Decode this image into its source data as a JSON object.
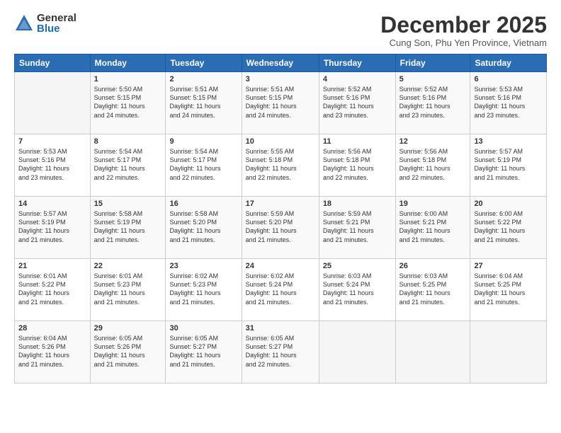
{
  "header": {
    "logo_general": "General",
    "logo_blue": "Blue",
    "month": "December 2025",
    "location": "Cung Son, Phu Yen Province, Vietnam"
  },
  "days_of_week": [
    "Sunday",
    "Monday",
    "Tuesday",
    "Wednesday",
    "Thursday",
    "Friday",
    "Saturday"
  ],
  "weeks": [
    [
      {
        "day": "",
        "info": ""
      },
      {
        "day": "1",
        "info": "Sunrise: 5:50 AM\nSunset: 5:15 PM\nDaylight: 11 hours\nand 24 minutes."
      },
      {
        "day": "2",
        "info": "Sunrise: 5:51 AM\nSunset: 5:15 PM\nDaylight: 11 hours\nand 24 minutes."
      },
      {
        "day": "3",
        "info": "Sunrise: 5:51 AM\nSunset: 5:15 PM\nDaylight: 11 hours\nand 24 minutes."
      },
      {
        "day": "4",
        "info": "Sunrise: 5:52 AM\nSunset: 5:16 PM\nDaylight: 11 hours\nand 23 minutes."
      },
      {
        "day": "5",
        "info": "Sunrise: 5:52 AM\nSunset: 5:16 PM\nDaylight: 11 hours\nand 23 minutes."
      },
      {
        "day": "6",
        "info": "Sunrise: 5:53 AM\nSunset: 5:16 PM\nDaylight: 11 hours\nand 23 minutes."
      }
    ],
    [
      {
        "day": "7",
        "info": "Sunrise: 5:53 AM\nSunset: 5:16 PM\nDaylight: 11 hours\nand 23 minutes."
      },
      {
        "day": "8",
        "info": "Sunrise: 5:54 AM\nSunset: 5:17 PM\nDaylight: 11 hours\nand 22 minutes."
      },
      {
        "day": "9",
        "info": "Sunrise: 5:54 AM\nSunset: 5:17 PM\nDaylight: 11 hours\nand 22 minutes."
      },
      {
        "day": "10",
        "info": "Sunrise: 5:55 AM\nSunset: 5:18 PM\nDaylight: 11 hours\nand 22 minutes."
      },
      {
        "day": "11",
        "info": "Sunrise: 5:56 AM\nSunset: 5:18 PM\nDaylight: 11 hours\nand 22 minutes."
      },
      {
        "day": "12",
        "info": "Sunrise: 5:56 AM\nSunset: 5:18 PM\nDaylight: 11 hours\nand 22 minutes."
      },
      {
        "day": "13",
        "info": "Sunrise: 5:57 AM\nSunset: 5:19 PM\nDaylight: 11 hours\nand 21 minutes."
      }
    ],
    [
      {
        "day": "14",
        "info": "Sunrise: 5:57 AM\nSunset: 5:19 PM\nDaylight: 11 hours\nand 21 minutes."
      },
      {
        "day": "15",
        "info": "Sunrise: 5:58 AM\nSunset: 5:19 PM\nDaylight: 11 hours\nand 21 minutes."
      },
      {
        "day": "16",
        "info": "Sunrise: 5:58 AM\nSunset: 5:20 PM\nDaylight: 11 hours\nand 21 minutes."
      },
      {
        "day": "17",
        "info": "Sunrise: 5:59 AM\nSunset: 5:20 PM\nDaylight: 11 hours\nand 21 minutes."
      },
      {
        "day": "18",
        "info": "Sunrise: 5:59 AM\nSunset: 5:21 PM\nDaylight: 11 hours\nand 21 minutes."
      },
      {
        "day": "19",
        "info": "Sunrise: 6:00 AM\nSunset: 5:21 PM\nDaylight: 11 hours\nand 21 minutes."
      },
      {
        "day": "20",
        "info": "Sunrise: 6:00 AM\nSunset: 5:22 PM\nDaylight: 11 hours\nand 21 minutes."
      }
    ],
    [
      {
        "day": "21",
        "info": "Sunrise: 6:01 AM\nSunset: 5:22 PM\nDaylight: 11 hours\nand 21 minutes."
      },
      {
        "day": "22",
        "info": "Sunrise: 6:01 AM\nSunset: 5:23 PM\nDaylight: 11 hours\nand 21 minutes."
      },
      {
        "day": "23",
        "info": "Sunrise: 6:02 AM\nSunset: 5:23 PM\nDaylight: 11 hours\nand 21 minutes."
      },
      {
        "day": "24",
        "info": "Sunrise: 6:02 AM\nSunset: 5:24 PM\nDaylight: 11 hours\nand 21 minutes."
      },
      {
        "day": "25",
        "info": "Sunrise: 6:03 AM\nSunset: 5:24 PM\nDaylight: 11 hours\nand 21 minutes."
      },
      {
        "day": "26",
        "info": "Sunrise: 6:03 AM\nSunset: 5:25 PM\nDaylight: 11 hours\nand 21 minutes."
      },
      {
        "day": "27",
        "info": "Sunrise: 6:04 AM\nSunset: 5:25 PM\nDaylight: 11 hours\nand 21 minutes."
      }
    ],
    [
      {
        "day": "28",
        "info": "Sunrise: 6:04 AM\nSunset: 5:26 PM\nDaylight: 11 hours\nand 21 minutes."
      },
      {
        "day": "29",
        "info": "Sunrise: 6:05 AM\nSunset: 5:26 PM\nDaylight: 11 hours\nand 21 minutes."
      },
      {
        "day": "30",
        "info": "Sunrise: 6:05 AM\nSunset: 5:27 PM\nDaylight: 11 hours\nand 21 minutes."
      },
      {
        "day": "31",
        "info": "Sunrise: 6:05 AM\nSunset: 5:27 PM\nDaylight: 11 hours\nand 22 minutes."
      },
      {
        "day": "",
        "info": ""
      },
      {
        "day": "",
        "info": ""
      },
      {
        "day": "",
        "info": ""
      }
    ]
  ]
}
